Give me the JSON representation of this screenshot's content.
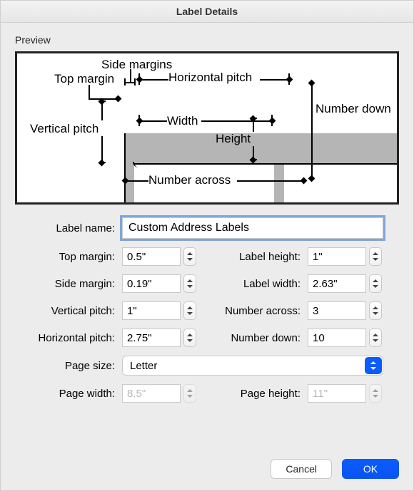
{
  "window_title": "Label Details",
  "preview_label": "Preview",
  "diagram": {
    "side_margins": "Side margins",
    "top_margin": "Top margin",
    "horizontal_pitch": "Horizontal pitch",
    "vertical_pitch": "Vertical pitch",
    "width": "Width",
    "height": "Height",
    "number_down": "Number down",
    "number_across": "Number across"
  },
  "form": {
    "label_name_label": "Label name:",
    "label_name_value": "Custom Address Labels",
    "top_margin_label": "Top margin:",
    "top_margin_value": "0.5\"",
    "label_height_label": "Label height:",
    "label_height_value": "1\"",
    "side_margin_label": "Side margin:",
    "side_margin_value": "0.19\"",
    "label_width_label": "Label width:",
    "label_width_value": "2.63\"",
    "vertical_pitch_label": "Vertical pitch:",
    "vertical_pitch_value": "1\"",
    "number_across_label": "Number across:",
    "number_across_value": "3",
    "horizontal_pitch_label": "Horizontal pitch:",
    "horizontal_pitch_value": "2.75\"",
    "number_down_label": "Number down:",
    "number_down_value": "10",
    "page_size_label": "Page size:",
    "page_size_value": "Letter",
    "page_width_label": "Page width:",
    "page_width_value": "8.5\"",
    "page_height_label": "Page height:",
    "page_height_value": "11\""
  },
  "buttons": {
    "cancel": "Cancel",
    "ok": "OK"
  }
}
